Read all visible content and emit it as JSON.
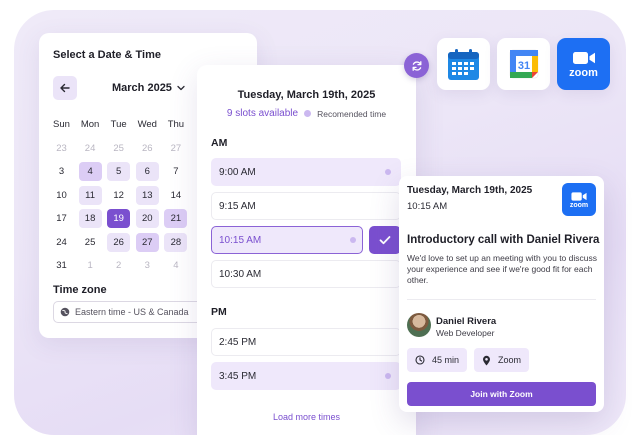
{
  "date_picker": {
    "title": "Select a Date & Time",
    "month": "March 2025",
    "weekdays": [
      "Sun",
      "Mon",
      "Tue",
      "Wed",
      "Thu"
    ],
    "weeks": [
      [
        {
          "d": "23",
          "s": "muted"
        },
        {
          "d": "24",
          "s": "muted"
        },
        {
          "d": "25",
          "s": "muted"
        },
        {
          "d": "26",
          "s": "muted"
        },
        {
          "d": "27",
          "s": "muted"
        }
      ],
      [
        {
          "d": "3",
          "s": "plain"
        },
        {
          "d": "4",
          "s": "strong"
        },
        {
          "d": "5",
          "s": "avail"
        },
        {
          "d": "6",
          "s": "avail"
        },
        {
          "d": "7",
          "s": "plain"
        }
      ],
      [
        {
          "d": "10",
          "s": "plain"
        },
        {
          "d": "11",
          "s": "avail"
        },
        {
          "d": "12",
          "s": "plain"
        },
        {
          "d": "13",
          "s": "avail"
        },
        {
          "d": "14",
          "s": "plain"
        }
      ],
      [
        {
          "d": "17",
          "s": "plain"
        },
        {
          "d": "18",
          "s": "avail"
        },
        {
          "d": "19",
          "s": "selected"
        },
        {
          "d": "20",
          "s": "avail"
        },
        {
          "d": "21",
          "s": "strong"
        }
      ],
      [
        {
          "d": "24",
          "s": "plain"
        },
        {
          "d": "25",
          "s": "plain"
        },
        {
          "d": "26",
          "s": "avail"
        },
        {
          "d": "27",
          "s": "strong"
        },
        {
          "d": "28",
          "s": "avail"
        }
      ],
      [
        {
          "d": "31",
          "s": "plain"
        },
        {
          "d": "1",
          "s": "muted"
        },
        {
          "d": "2",
          "s": "muted"
        },
        {
          "d": "3",
          "s": "muted"
        },
        {
          "d": "4",
          "s": "muted"
        }
      ]
    ],
    "timezone_label": "Time zone",
    "timezone_value": "Eastern time - US & Canada"
  },
  "slots": {
    "date": "Tuesday, March 19th, 2025",
    "count": "9 slots available",
    "recommended_label": "Recomended time",
    "am_label": "AM",
    "pm_label": "PM",
    "am": [
      {
        "time": "9:00 AM",
        "state": "recommended"
      },
      {
        "time": "9:15 AM",
        "state": "normal"
      },
      {
        "time": "10:15 AM",
        "state": "selected"
      },
      {
        "time": "10:30 AM",
        "state": "normal"
      }
    ],
    "pm": [
      {
        "time": "2:45 PM",
        "state": "normal"
      },
      {
        "time": "3:45 PM",
        "state": "recommended"
      }
    ],
    "load_more": "Load more times"
  },
  "apps": {
    "calendar_day": "31",
    "zoom_word": "zoom"
  },
  "meeting": {
    "date": "Tuesday, March 19th, 2025",
    "time": "10:15 AM",
    "zoom_word": "zoom",
    "title": "Introductory call with Daniel Rivera",
    "description": "We'd love to set up an meeting with you to discuss your experience and see if we're good fit for each other.",
    "host_name": "Daniel Rivera",
    "host_role": "Web Developer",
    "duration": "45 min",
    "location": "Zoom",
    "join_label": "Join with Zoom"
  },
  "colors": {
    "accent": "#7a4fcf",
    "accent_light": "#efe8fb",
    "zoom_blue": "#1d6ff3"
  }
}
